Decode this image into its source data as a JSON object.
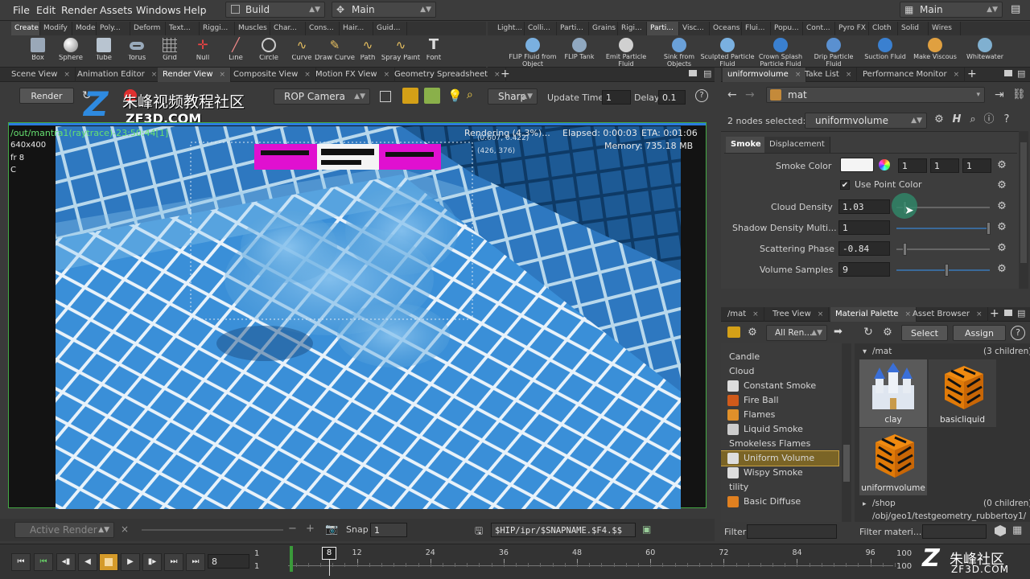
{
  "menu": {
    "items": [
      "File",
      "Edit",
      "Render",
      "Assets",
      "Windows",
      "Help"
    ],
    "desktop": "Build",
    "network": "Main",
    "right_desktop": "Main"
  },
  "shelf_tabs": [
    "Create",
    "Modify",
    "Model",
    "Poly...",
    "Deform",
    "Text...",
    "Riggi...",
    "Muscles",
    "Char...",
    "Cons...",
    "Hair...",
    "Guid..."
  ],
  "shelf_tabs2": [
    "Light...",
    "Colli...",
    "Parti...",
    "Grains",
    "Rigi...",
    "Parti...",
    "Visc...",
    "Oceans",
    "Flui...",
    "Popu...",
    "Cont...",
    "Pyro FX",
    "Cloth",
    "Solid",
    "Wires"
  ],
  "tools": [
    "Box",
    "Sphere",
    "Tube",
    "Torus",
    "Grid",
    "Null",
    "Line",
    "Circle",
    "Curve",
    "Draw Curve",
    "Path",
    "Spray Paint",
    "Font"
  ],
  "tools2": [
    "FLIP Fluid from Object",
    "FLIP Tank",
    "Emit Particle Fluid",
    "Sink from Objects",
    "Sculpted Particle Fluid",
    "Crown Splash Particle Fluid",
    "Drip Particle Fluid",
    "Suction Fluid",
    "Make Viscous",
    "Whitewater"
  ],
  "viewer": {
    "tabs": [
      "Scene View",
      "Animation Editor",
      "Render View",
      "Composite View",
      "Motion FX View",
      "Geometry Spreadsheet"
    ],
    "render_button": "Render",
    "camera": "ROP Camera",
    "sharp": "Sharp",
    "update_time_label": "Update Time",
    "update_time_value": "1",
    "delay_label": "Delay",
    "delay_value": "0.1",
    "path_info": "/out/mantra1(raytrace)-23:50:44[1]",
    "resolution": "640x400",
    "frame": "fr 8",
    "channel": "C",
    "status": "Rendering (4.3%)...",
    "elapsed": "Elapsed: 0:00:03",
    "eta": "ETA: 0:01:06",
    "memory": "Memory:  735.18 MB",
    "pixel_info": "(0.607, 0.422)",
    "pixel_coords": "(426, 376)",
    "snapshot_label": "Active Render",
    "snap_label": "Snap",
    "snap_value": "1",
    "snap_path": "$HIP/ipr/$SNAPNAME.$F4.$$",
    "watermark_cn": "朱峰视频教程社区",
    "watermark_url": "ZF3D.COM",
    "watermark_letter": "Z"
  },
  "params": {
    "tabs": [
      "uniformvolume",
      "Take List",
      "Performance Monitor"
    ],
    "node_path": "mat",
    "nodes_selected": "2 nodes selected:",
    "node_name": "uniformvolume",
    "subtabs": [
      "Smoke",
      "Displacement"
    ],
    "smoke_color_label": "Smoke Color",
    "smoke_color": [
      "1",
      "1",
      "1"
    ],
    "use_point_color": "Use Point Color",
    "cloud_density_label": "Cloud Density",
    "cloud_density": "1.03",
    "shadow_density_label": "Shadow Density Multi...",
    "shadow_density": "1",
    "scattering_phase_label": "Scattering Phase",
    "scattering_phase": "-0.84",
    "volume_samples_label": "Volume Samples",
    "volume_samples": "9"
  },
  "palette": {
    "tabs": [
      "/mat",
      "Tree View",
      "Material Palette",
      "Asset Browser"
    ],
    "filter_dropdown": "All Ren...",
    "select": "Select",
    "assign": "Assign",
    "list": [
      {
        "label": "Candle",
        "type": "cat"
      },
      {
        "label": "Cloud",
        "type": "cat"
      },
      {
        "label": "Constant Smoke",
        "type": "item"
      },
      {
        "label": "Fire Ball",
        "type": "item"
      },
      {
        "label": "Flames",
        "type": "item"
      },
      {
        "label": "Liquid Smoke",
        "type": "item"
      },
      {
        "label": "Smokeless Flames",
        "type": "cat"
      },
      {
        "label": "Uniform Volume",
        "type": "item"
      },
      {
        "label": "Wispy Smoke",
        "type": "item"
      },
      {
        "label": "tility",
        "type": "cat"
      },
      {
        "label": "Basic Diffuse",
        "type": "item"
      }
    ],
    "mat_path": "/mat",
    "mat_children": "(3 children)",
    "shop_path": "/shop",
    "shop_children": "(0 children)",
    "obj_path": "/obj/geo1/testgeometry_rubbertoy1/",
    "materials": [
      "clay",
      "basicliquid",
      "uniformvolume"
    ],
    "filter_label": "Filter",
    "filter_materials": "Filter materi..."
  },
  "timeline": {
    "current_frame": "8",
    "start": "1",
    "start2": "1",
    "end": "100",
    "end2": "100",
    "ticks": [
      "12",
      "24",
      "36",
      "48",
      "60",
      "72",
      "84",
      "96"
    ],
    "frame_marker": "8"
  },
  "corner_watermark": {
    "cn": "朱峰社区",
    "url": "ZF3D.COM"
  }
}
